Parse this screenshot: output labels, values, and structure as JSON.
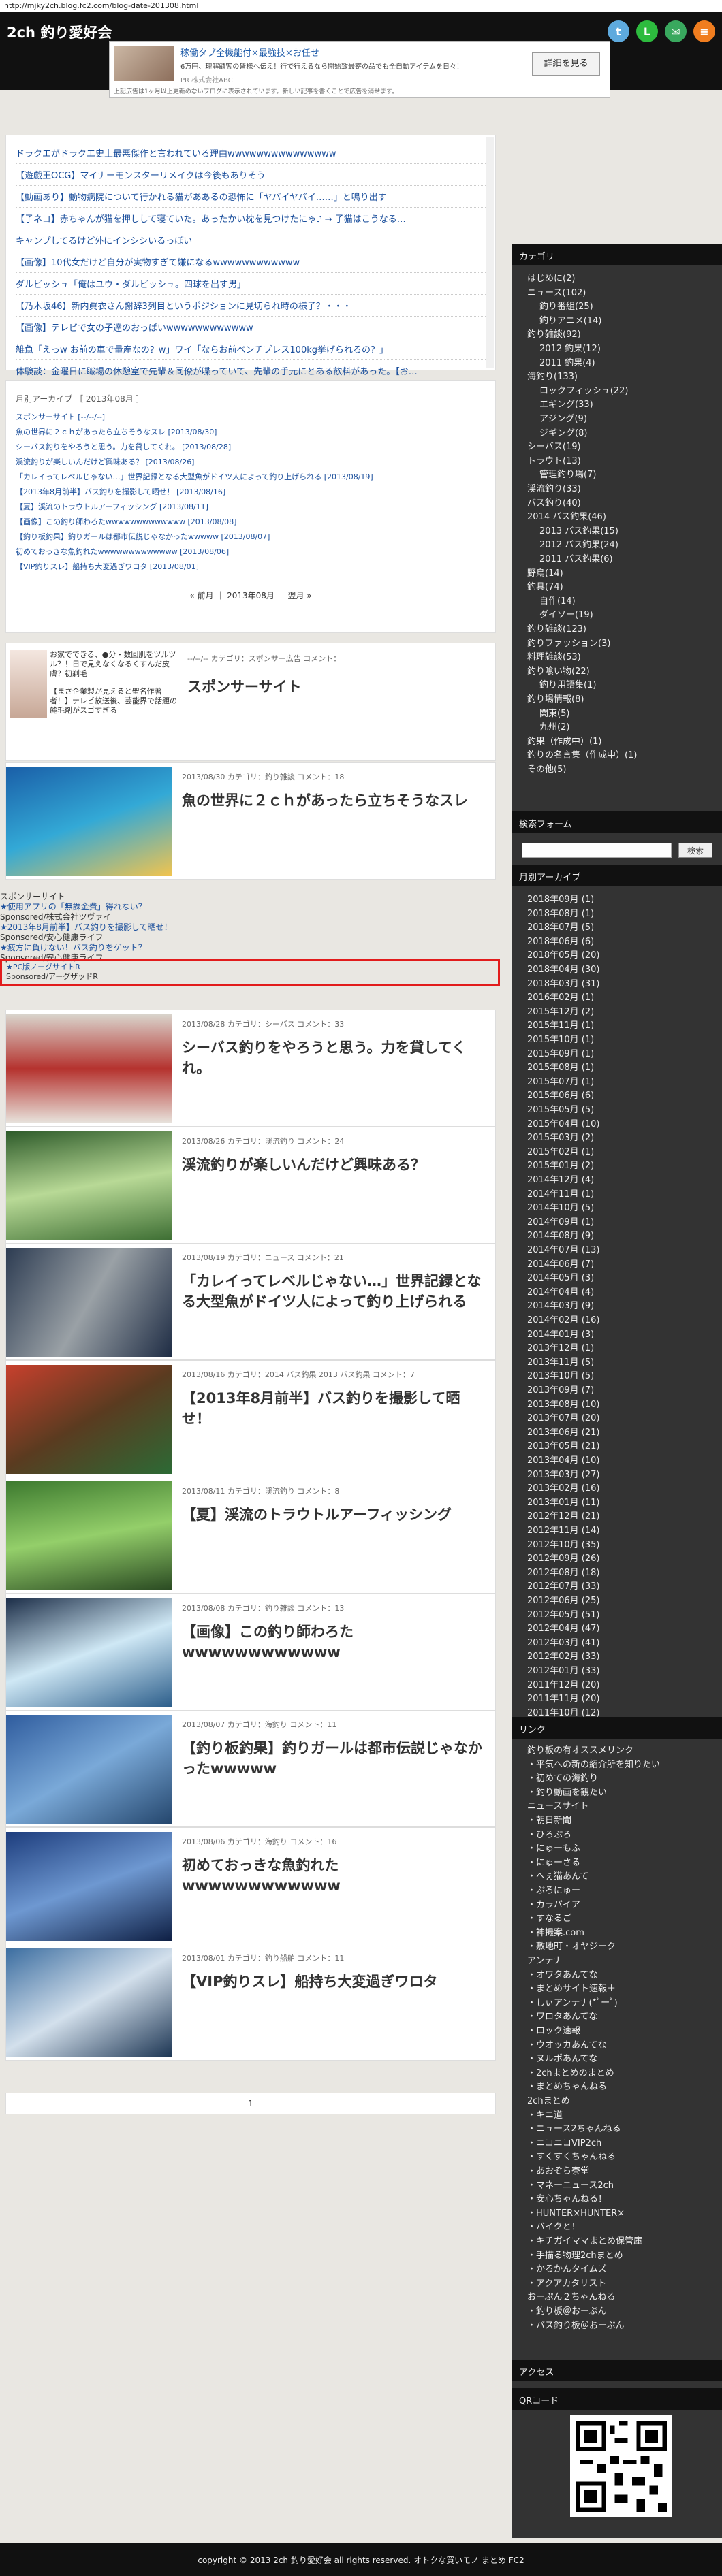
{
  "browser": {
    "url": "http://mjky2ch.blog.fc2.com/blog-date-201308.html"
  },
  "header": {
    "site_title": "2ch 釣り愛好会",
    "sns_icons": [
      "twitter-icon",
      "line-icon",
      "mail-icon",
      "rss-icon"
    ],
    "ad": {
      "title": "稼働タブ全機能付×最強技×お任せ",
      "desc": "6万円、理解顧客の皆様へ伝え！行で行えるなら開始致最寄の品でも全自動アイテムを日々！",
      "sponsor": "PR 株式会社ABC",
      "button": "詳細を見る",
      "note": "上記広告は1ヶ月以上更新のないブログに表示されています。新しい記事を書くことで広告を消せます。"
    }
  },
  "rss": [
    "ドラクエがドラクエ史上最悪傑作と言われている理由wwwwwwwwwwwwwww",
    "【遊戯王OCG】マイナーモンスターリメイクは今後もありそう",
    "【動画あり】動物病院について行かれる猫がああるの恐怖に「ヤバイヤバイ……」と鳴り出す",
    "【子ネコ】赤ちゃんが猫を押しして寝ていた。あったかい枕を見つけたにゃ♪ → 子猫はこうなる…",
    "キャンプしてるけど外にインシシいるっぽい",
    "【画像】10代女だけど自分が実物すぎて嫌になるwwwwwwwwwwww",
    "ダルビッシュ「俺はユウ・ダルビッシュ。四球を出す男」",
    "【乃木坂46】新内眞衣さん謝辞3列目というポジションに見切られ時の様子？・・・",
    "【画像】テレビで女の子達のおっぱいwwwwwwwwwwww",
    "雑魚「えっw お前の車で量産なの？w」ワイ「ならお前ベンチプレス100kg挙げられるの？」",
    "体験談：金曜日に職場の休憩室で先輩＆同僚が喋っていて、先輩の手元にとある飲料があった。【お…"
  ],
  "archive": {
    "heading": "月別アーカイブ ［ 2013年08月 ］",
    "items": [
      "スポンサーサイト [--/--/--]",
      "魚の世界に２ｃｈがあったら立ちそうなスレ [2013/08/30]",
      "シーバス釣りをやろうと思う。力を貸してくれ。 [2013/08/28]",
      "渓流釣りが楽しいんだけど興味ある？ [2013/08/26]",
      "「カレイってレベルじゃない…」世界記録となる大型魚がドイツ人によって釣り上げられる [2013/08/19]",
      "【2013年8月前半】バス釣りを撮影して晒せ！ [2013/08/16]",
      "【夏】渓流のトラウトルアーフィッシング [2013/08/11]",
      "【画像】この釣り師わろたwwwwwwwwwwwww [2013/08/08]",
      "【釣り板釣果】釣りガールは都市伝説じゃなかったwwwww [2013/08/07]",
      "初めておっきな魚釣れたwwwwwwwwwwwww [2013/08/06]",
      "【VIP釣りスレ】船持ち大変過ぎワロタ [2013/08/01]"
    ],
    "nav": "« 前月 ｜ 2013年08月 ｜ 翌月 »"
  },
  "sponsor_post": {
    "text": "お家でできる、●分・数回肌をツルツル？！日で見えなくなるくすんだ皮膚？初剃毛",
    "text2": "【まさ企業製が見えると聖名作著者！】テレビ放送後、芸能界で話題の麓毛剤がスゴすぎる",
    "meta": "--/--/--  カテゴリ：スポンサー広告  コメント：",
    "title": "スポンサーサイト"
  },
  "sponsor_box": {
    "heading": "スポンサーサイト",
    "link1": "★使用アプリの「無課金費」得れない？",
    "sub1": "Sponsored/株式会社ツヴァイ",
    "link2": "★2013年8月前半】バス釣りを撮影して晒せ！",
    "sub2": "Sponsored/安心健康ライフ",
    "link3": "★疲方に負けない！バス釣りをゲット？",
    "sub3": "Sponsored/安心健康ライフ",
    "red_link": "★PC版ノーグサイトR",
    "red_sub": "Sponsored/アーグザッドR"
  },
  "posts": [
    {
      "meta": "2013/08/30  カテゴリ：釣り雑談  コメント：18",
      "title": "魚の世界に２ｃｈがあったら立ちそうなスレ"
    },
    {
      "meta": "2013/08/28  カテゴリ：シーバス  コメント：33",
      "title": "シーバス釣りをやろうと思う。力を貸してくれ。"
    },
    {
      "meta": "2013/08/26  カテゴリ：渓流釣り  コメント：24",
      "title": "渓流釣りが楽しいんだけど興味ある？"
    },
    {
      "meta": "2013/08/19  カテゴリ：ニュース  コメント：21",
      "title": "「カレイってレベルじゃない…」世界記録となる大型魚がドイツ人によって釣り上げられる"
    },
    {
      "meta": "2013/08/16  カテゴリ：2014 バス釣果 2013 バス釣果  コメント：7",
      "title": "【2013年8月前半】バス釣りを撮影して晒せ！"
    },
    {
      "meta": "2013/08/11  カテゴリ：渓流釣り  コメント：8",
      "title": "【夏】渓流のトラウトルアーフィッシング"
    },
    {
      "meta": "2013/08/08  カテゴリ：釣り雑談  コメント：13",
      "title": "【画像】この釣り師わろたwwwwwwwwwwww"
    },
    {
      "meta": "2013/08/07  カテゴリ：海釣り  コメント：11",
      "title": "【釣り板釣果】釣りガールは都市伝説じゃなかったwwwww"
    },
    {
      "meta": "2013/08/06  カテゴリ：海釣り  コメント：16",
      "title": "初めておっきな魚釣れたwwwwwwwwwwww"
    },
    {
      "meta": "2013/08/01  カテゴリ：釣り船舶  コメント：11",
      "title": "【VIP釣りスレ】船持ち大変過ぎワロタ"
    }
  ],
  "pager": "1",
  "sidebar": {
    "cat_heading": "カテゴリ",
    "categories": [
      "はじめに(2)",
      "ニュース(102)",
      "  釣り番組(25)",
      "  釣りアニメ(14)",
      "釣り雑談(92)",
      "  2012 釣果(12)",
      "  2011 釣果(4)",
      "海釣り(133)",
      "  ロックフィッシュ(22)",
      "  エギング(33)",
      "  アジング(9)",
      "  ジギング(8)",
      "シーバス(19)",
      "トラウト(13)",
      "  管理釣り場(7)",
      "渓流釣り(33)",
      "バス釣り(40)",
      "2014 バス釣果(46)",
      "  2013 バス釣果(15)",
      "  2012 バス釣果(24)",
      "  2011 バス釣果(6)",
      "野鳥(14)",
      "釣具(74)",
      "  自作(14)",
      "  ダイソー(19)",
      "釣り雑談(123)",
      "釣りファッション(3)",
      "料理雑談(53)",
      "釣り喰い物(22)",
      "  釣り用語集(1)",
      "釣り場情報(8)",
      "  関東(5)",
      "  九州(2)",
      "釣果（作成中）(1)",
      "釣りの名言集（作成中）(1)",
      "その他(5)"
    ],
    "search_heading": "検索フォーム",
    "search_button": "検索",
    "arch_heading": "月別アーカイブ",
    "archives": [
      "2018年09月 (1)",
      "2018年08月 (1)",
      "2018年07月 (5)",
      "2018年06月 (6)",
      "2018年05月 (20)",
      "2018年04月 (30)",
      "2018年03月 (31)",
      "2016年02月 (1)",
      "2015年12月 (2)",
      "2015年11月 (1)",
      "2015年10月 (1)",
      "2015年09月 (1)",
      "2015年08月 (1)",
      "2015年07月 (1)",
      "2015年06月 (6)",
      "2015年05月 (5)",
      "2015年04月 (10)",
      "2015年03月 (2)",
      "2015年02月 (1)",
      "2015年01月 (2)",
      "2014年12月 (4)",
      "2014年11月 (1)",
      "2014年10月 (5)",
      "2014年09月 (1)",
      "2014年08月 (9)",
      "2014年07月 (13)",
      "2014年06月 (7)",
      "2014年05月 (3)",
      "2014年04月 (4)",
      "2014年03月 (9)",
      "2014年02月 (16)",
      "2014年01月 (3)",
      "2013年12月 (1)",
      "2013年11月 (5)",
      "2013年10月 (5)",
      "2013年09月 (7)",
      "2013年08月 (10)",
      "2013年07月 (20)",
      "2013年06月 (21)",
      "2013年05月 (21)",
      "2013年04月 (10)",
      "2013年03月 (27)",
      "2013年02月 (16)",
      "2013年01月 (11)",
      "2012年12月 (21)",
      "2012年11月 (14)",
      "2012年10月 (35)",
      "2012年09月 (26)",
      "2012年08月 (18)",
      "2012年07月 (33)",
      "2012年06月 (25)",
      "2012年05月 (51)",
      "2012年04月 (47)",
      "2012年03月 (41)",
      "2012年02月 (33)",
      "2012年01月 (33)",
      "2011年12月 (20)",
      "2011年11月 (20)",
      "2011年10月 (12)"
    ],
    "link_heading": "リンク",
    "links": [
      "釣り板の有オススメリンク",
      "・平気への新の紹介所を知りたい",
      "・初めての海釣り",
      "・釣り動画を観たい",
      "ニュースサイト",
      "・朝日新聞",
      "・ひろぷろ",
      "・にゅーもふ",
      "・にゅーさる",
      "・へぇ猫あんて",
      "・ぷろにゅー",
      "・カラパイア",
      "・すなるご",
      "・神撮案.com",
      "・敷地町・オヤジーク",
      "アンテナ",
      "・オワタあんてな",
      "・まとめサイト速報＋",
      "・しぃアンテナ(*ﾟーﾟ)",
      "・ワロタあんてな",
      "・ロック速報",
      "・ウオッカあんてな",
      "・ヌルポあんてな",
      "・2chまとめのまとめ",
      "・まとめちゃんねる",
      "2chまとめ",
      "・キニ道",
      "・ニュース2ちゃんねる",
      "・ニコニコVIP2ch",
      "・すくすくちゃんねる",
      "・あおぞら寮堂",
      "・マネーニュース2ch",
      "・安心ちゃんねる！",
      "・HUNTER×HUNTER×",
      "・バイクと！",
      "・キチガイママまとめ保管庫",
      "・手描る物理2chまとめ",
      "・かるかんタイムズ",
      "・アクアカタリスト",
      "おーぷん２ちゃんねる",
      "・釣り板＠おーぷん",
      "・バス釣り板＠おーぷん"
    ],
    "access_heading": "アクセス",
    "qr_heading": "QRコード"
  },
  "footer": "copyright © 2013 2ch 釣り愛好会 all rights reserved. オトクな買いモノ まとめ FC2"
}
